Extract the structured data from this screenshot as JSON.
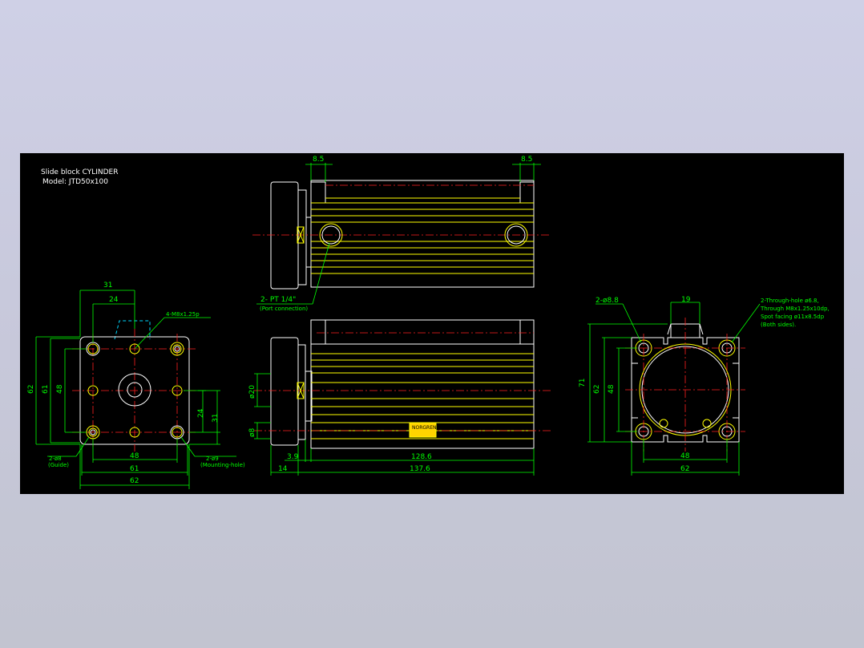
{
  "title": {
    "line1": "Slide block  CYLINDER",
    "line2": "Model:  JTD50x100"
  },
  "colors": {
    "background": "#000000",
    "outline": "#ffffff",
    "detail": "#ffff00",
    "dimension": "#00ff00",
    "centerline": "#ff2020",
    "hidden": "#00d8ff"
  },
  "left_view": {
    "dims": {
      "top_31": "31",
      "top_24": "24",
      "left_62": "62",
      "left_61": "61",
      "left_48": "48",
      "right_24": "24",
      "right_31": "31",
      "bottom_48": "48",
      "bottom_61": "61",
      "bottom_62": "62"
    },
    "notes": {
      "thread": "4-M8x1.25p",
      "guide_dia": "2-ø8",
      "guide": "(Guide)",
      "mount_dia": "2-ø9",
      "mount": "(Mounting-hole)"
    }
  },
  "top_view": {
    "dims": {
      "left_8_5": "8.5",
      "right_8_5": "8.5"
    },
    "notes": {
      "port": "2-  PT 1/4\"",
      "port_sub": "(Port connection)"
    }
  },
  "front_view": {
    "dims": {
      "rod_dia": "ø20",
      "guide_dia": "ø8",
      "d_3_9": "3.9",
      "d_14": "14",
      "d_128_6": "128.6",
      "d_137_6": "137.6"
    },
    "label_plate": "NORGREN"
  },
  "right_view": {
    "dims": {
      "top_19": "19",
      "left_71": "71",
      "left_62": "62",
      "left_48": "48",
      "bottom_48": "48",
      "bottom_62": "62"
    },
    "notes": {
      "holes": "2-ø8.8",
      "through_1": "2-Through-hole ø6.8,",
      "through_2": "Through M8x1.25x10dp,",
      "through_3": "Spot facing ø11x8.5dp",
      "through_4": "(Both sides)."
    }
  }
}
